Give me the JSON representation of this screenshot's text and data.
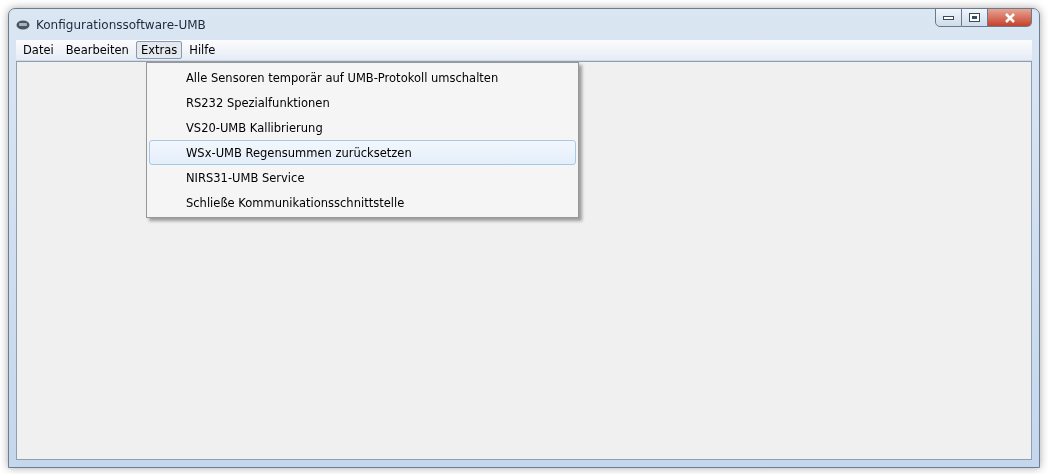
{
  "window": {
    "title": "Konfigurationssoftware-UMB"
  },
  "menu_bar": [
    {
      "label": "Datei",
      "selected": false
    },
    {
      "label": "Bearbeiten",
      "selected": false
    },
    {
      "label": "Extras",
      "selected": true
    },
    {
      "label": "Hilfe",
      "selected": false
    }
  ],
  "dropdown": [
    {
      "label": "Alle Sensoren temporär auf UMB-Protokoll umschalten",
      "selected": false
    },
    {
      "label": "RS232 Spezialfunktionen",
      "selected": false
    },
    {
      "label": "VS20-UMB Kallibrierung",
      "selected": false
    },
    {
      "label": "WSx-UMB Regensummen zurücksetzen",
      "selected": true
    },
    {
      "label": "NIRS31-UMB Service",
      "selected": false
    },
    {
      "label": "Schließe Kommunikationsschnittstelle",
      "selected": false
    }
  ]
}
